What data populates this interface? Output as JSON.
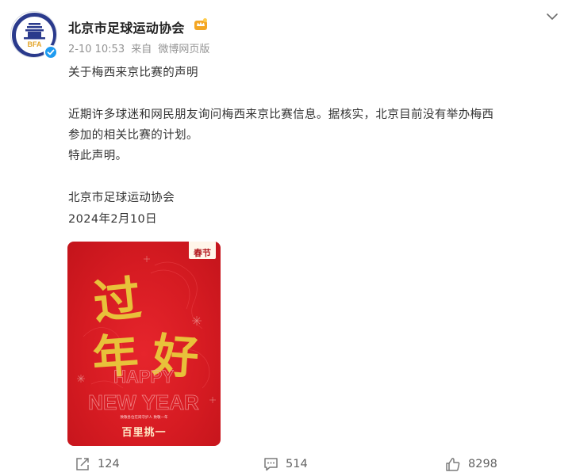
{
  "account": {
    "name": "北京市足球运动协会",
    "date": "2-10 10:53",
    "source_prefix": "来自",
    "source": "微博网页版",
    "avatar_text": "BFA"
  },
  "post": {
    "title_line": "关于梅西来京比赛的声明",
    "body_line1": "近期许多球迷和网民朋友询问梅西来京比赛信息。据核实，北京目前没有举办梅西",
    "body_line2": "参加的相关比赛的计划。",
    "body_line3": "特此声明。",
    "signature": "北京市足球运动协会",
    "sign_date": "2024年2月10日"
  },
  "image_card": {
    "tag_small": "春节",
    "tag_big": "春节",
    "headline": "过年好",
    "english_line1": "HAPPY",
    "english_line2": "NEW YEAR",
    "caption": "致敬各位在岗守护人 致敬一年",
    "title": "百里挑一",
    "bg_color": "#d61b22",
    "gold_color": "#e8c13a"
  },
  "actions": {
    "repost_count": "124",
    "comment_count": "514",
    "like_count": "8298"
  },
  "icons": {
    "repost": "share-arrow-icon",
    "comment": "comment-bubble-icon",
    "like": "thumbs-up-icon",
    "menu": "chevron-down-icon",
    "verified": "verified-check-icon",
    "badge": "member-crown-icon"
  },
  "colors": {
    "text": "#333333",
    "meta": "#939393",
    "verified": "#1e9bf0",
    "badge": "#f4a623"
  }
}
